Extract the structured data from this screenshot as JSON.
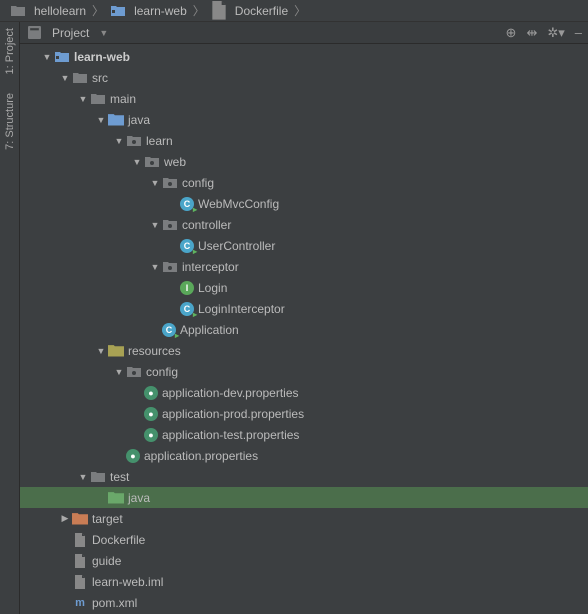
{
  "breadcrumb": [
    {
      "label": "hellolearn",
      "icon": "folder"
    },
    {
      "label": "learn-web",
      "icon": "module"
    },
    {
      "label": "Dockerfile",
      "icon": "file"
    }
  ],
  "toolwindow": {
    "title": "Project",
    "icons": [
      "target",
      "collapse",
      "gear",
      "hide"
    ]
  },
  "sidebar": {
    "tabs": [
      {
        "num": "1",
        "label": "Project"
      },
      {
        "num": "7",
        "label": "Structure"
      }
    ]
  },
  "tree": [
    {
      "d": 0,
      "arrow": "down",
      "icon": "module",
      "label": "learn-web",
      "bold": true
    },
    {
      "d": 1,
      "arrow": "down",
      "icon": "folder",
      "label": "src"
    },
    {
      "d": 2,
      "arrow": "down",
      "icon": "folder",
      "label": "main"
    },
    {
      "d": 3,
      "arrow": "down",
      "icon": "source",
      "label": "java"
    },
    {
      "d": 4,
      "arrow": "down",
      "icon": "package",
      "label": "learn"
    },
    {
      "d": 5,
      "arrow": "down",
      "icon": "package",
      "label": "web"
    },
    {
      "d": 6,
      "arrow": "down",
      "icon": "package",
      "label": "config"
    },
    {
      "d": 7,
      "arrow": "none",
      "icon": "class",
      "label": "WebMvcConfig",
      "run": true
    },
    {
      "d": 6,
      "arrow": "down",
      "icon": "package",
      "label": "controller"
    },
    {
      "d": 7,
      "arrow": "none",
      "icon": "class",
      "label": "UserController",
      "run": true
    },
    {
      "d": 6,
      "arrow": "down",
      "icon": "package",
      "label": "interceptor"
    },
    {
      "d": 7,
      "arrow": "none",
      "icon": "interface",
      "label": "Login"
    },
    {
      "d": 7,
      "arrow": "none",
      "icon": "class",
      "label": "LoginInterceptor",
      "run": true
    },
    {
      "d": 6,
      "arrow": "none",
      "icon": "class",
      "label": "Application",
      "run": true
    },
    {
      "d": 3,
      "arrow": "down",
      "icon": "resources",
      "label": "resources"
    },
    {
      "d": 4,
      "arrow": "down",
      "icon": "package",
      "label": "config"
    },
    {
      "d": 5,
      "arrow": "none",
      "icon": "prop",
      "label": "application-dev.properties"
    },
    {
      "d": 5,
      "arrow": "none",
      "icon": "prop",
      "label": "application-prod.properties"
    },
    {
      "d": 5,
      "arrow": "none",
      "icon": "prop",
      "label": "application-test.properties"
    },
    {
      "d": 4,
      "arrow": "none",
      "icon": "prop",
      "label": "application.properties"
    },
    {
      "d": 2,
      "arrow": "down",
      "icon": "folder",
      "label": "test"
    },
    {
      "d": 3,
      "arrow": "none",
      "icon": "testfolder",
      "label": "java",
      "selected": true
    },
    {
      "d": 1,
      "arrow": "right",
      "icon": "target",
      "label": "target"
    },
    {
      "d": 1,
      "arrow": "none",
      "icon": "file",
      "label": "Dockerfile"
    },
    {
      "d": 1,
      "arrow": "none",
      "icon": "file",
      "label": "guide"
    },
    {
      "d": 1,
      "arrow": "none",
      "icon": "file",
      "label": "learn-web.iml"
    },
    {
      "d": 1,
      "arrow": "none",
      "icon": "maven",
      "label": "pom.xml"
    }
  ]
}
